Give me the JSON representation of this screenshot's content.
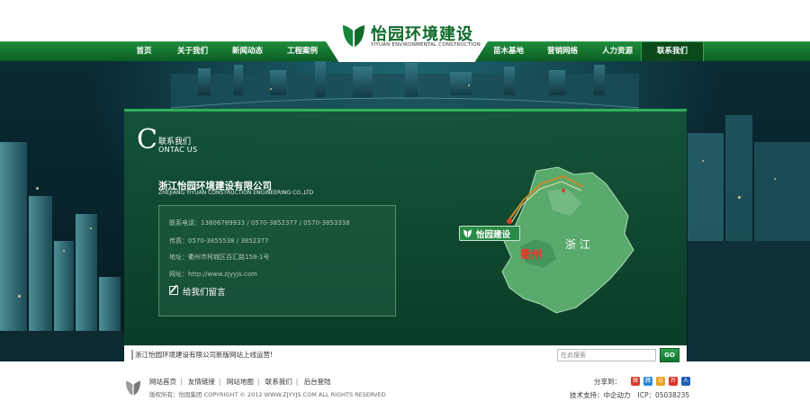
{
  "logo": {
    "name_cn": "怡园环境建设",
    "name_en": "YIYUAN ENVIRONMENTAL CONSTRUCTION"
  },
  "nav": {
    "items": [
      {
        "label": "首页"
      },
      {
        "label": "关于我们"
      },
      {
        "label": "新闻动态"
      },
      {
        "label": "工程案例"
      },
      {
        "label": "苗木基地"
      },
      {
        "label": "营销网络"
      },
      {
        "label": "人力资源"
      },
      {
        "label": "联系我们",
        "active": true
      }
    ]
  },
  "contact": {
    "title_initial": "C",
    "title_cn": "联系我们",
    "title_en_rest": "ONTAC US",
    "company_cn": "浙江怡园环境建设有限公司",
    "company_en": "ZHEJIANG YIYUAN CONSTRUCTION ENGINEERING CO.,LTD",
    "phone": "联系电话：13806789933  / 0570-3852377 / 0570-3853338",
    "fax": "传真：0570-3855538 / 3852377",
    "address": "地址：衢州市柯城区百汇路158-1号",
    "website": "网址：http://www.zjyyjs.com",
    "message_label": "给我们留言"
  },
  "map": {
    "brand_label": "怡园建设",
    "province_label": "浙 江",
    "city_label": "衢州"
  },
  "notice": {
    "text": "浙江怡园环境建设有限公司新版网站上线运营!"
  },
  "search": {
    "placeholder": "在此搜索",
    "button_label": "GO"
  },
  "footer": {
    "links": [
      "网站首页",
      "友情链接",
      "网站地图",
      "联系我们",
      "后台登陆"
    ],
    "copyright": "版权所有：怡园集团 COPYRIGHT © 2012 WWW.ZJYYJS.COM ALL RIGHTS RESERVED",
    "share_label": "分享到：",
    "share_icons": [
      "sina-weibo-icon",
      "tencent-weibo-icon",
      "qzone-icon",
      "kaixin-icon",
      "renren-icon"
    ],
    "tech_support": "技术支持：中企动力",
    "icp": "ICP：05038235"
  },
  "colors": {
    "brand_green": "#0f6a2a",
    "nav_green": "#1f8b3c",
    "panel_green": "#145437"
  }
}
